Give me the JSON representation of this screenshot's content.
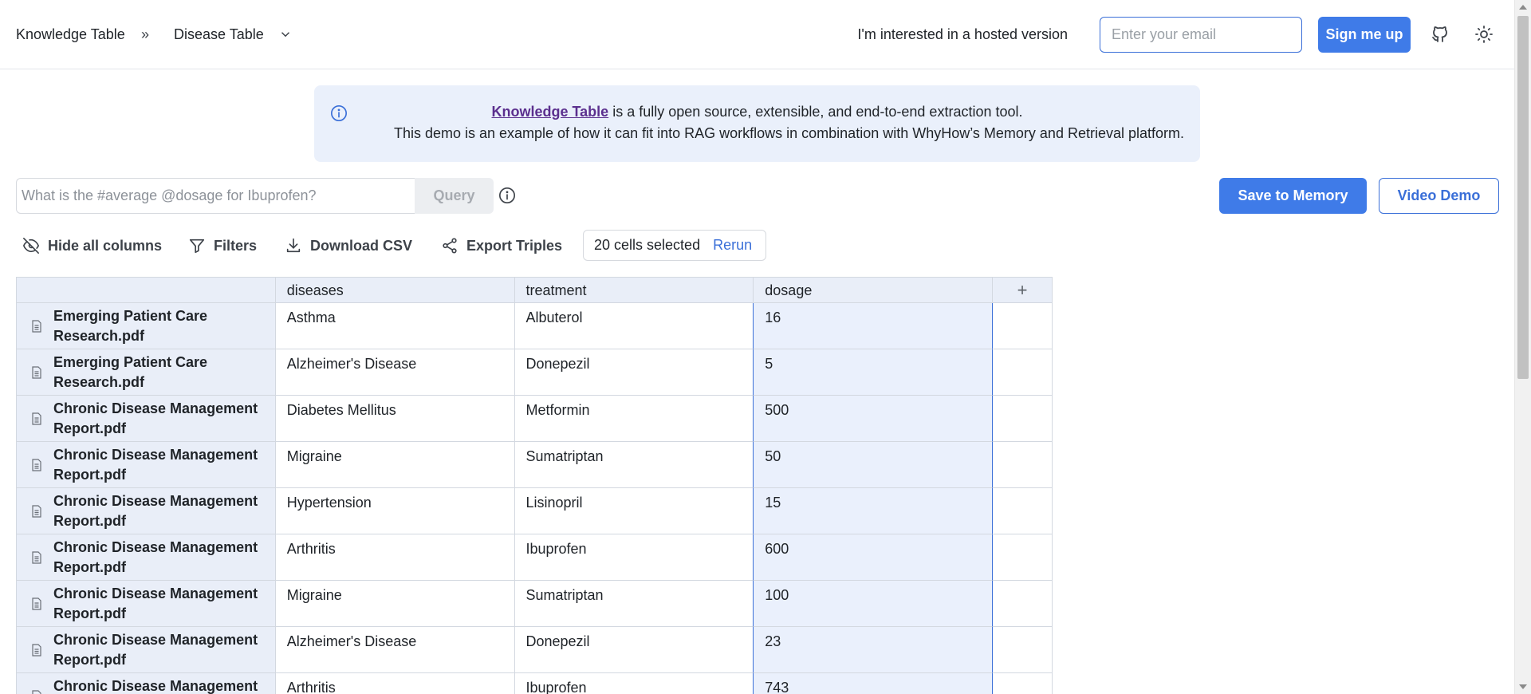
{
  "header": {
    "breadcrumb_root": "Knowledge Table",
    "breadcrumb_separator": "»",
    "breadcrumb_current": "Disease Table",
    "hosted_text": "I'm interested in a hosted version",
    "email_placeholder": "Enter your email",
    "signup_label": "Sign me up"
  },
  "banner": {
    "link_text": "Knowledge Table",
    "line1_rest": " is a fully open source, extensible, and end-to-end extraction tool.",
    "line2": "This demo is an example of how it can fit into RAG workflows in combination with WhyHow’s Memory and Retrieval platform."
  },
  "query": {
    "placeholder": "What is the #average @dosage for Ibuprofen?",
    "button_label": "Query"
  },
  "actions": {
    "save_label": "Save to Memory",
    "video_label": "Video Demo"
  },
  "toolbar": {
    "hide_columns": "Hide all columns",
    "filters": "Filters",
    "download_csv": "Download CSV",
    "export_triples": "Export Triples",
    "cells_selected": "20 cells selected",
    "rerun": "Rerun"
  },
  "table": {
    "columns": [
      "diseases",
      "treatment",
      "dosage"
    ],
    "add_column": "+",
    "rows": [
      {
        "document": "Emerging Patient Care Research.pdf",
        "diseases": "Asthma",
        "treatment": "Albuterol",
        "dosage": "16"
      },
      {
        "document": "Emerging Patient Care Research.pdf",
        "diseases": "Alzheimer's Disease",
        "treatment": "Donepezil",
        "dosage": "5"
      },
      {
        "document": "Chronic Disease Management Report.pdf",
        "diseases": "Diabetes Mellitus",
        "treatment": "Metformin",
        "dosage": "500"
      },
      {
        "document": "Chronic Disease Management Report.pdf",
        "diseases": "Migraine",
        "treatment": "Sumatriptan",
        "dosage": "50"
      },
      {
        "document": "Chronic Disease Management Report.pdf",
        "diseases": "Hypertension",
        "treatment": "Lisinopril",
        "dosage": "15"
      },
      {
        "document": "Chronic Disease Management Report.pdf",
        "diseases": "Arthritis",
        "treatment": "Ibuprofen",
        "dosage": "600"
      },
      {
        "document": "Chronic Disease Management Report.pdf",
        "diseases": "Migraine",
        "treatment": "Sumatriptan",
        "dosage": "100"
      },
      {
        "document": "Chronic Disease Management Report.pdf",
        "diseases": "Alzheimer's Disease",
        "treatment": "Donepezil",
        "dosage": "23"
      },
      {
        "document": "Chronic Disease Management Report.pdf",
        "diseases": "Arthritis",
        "treatment": "Ibuprofen",
        "dosage": "743"
      }
    ]
  },
  "colors": {
    "accent": "#3f7be8",
    "banner_bg": "#eaf0fb",
    "link": "#5b2f8e",
    "selected_cell_bg": "#eaf0fc"
  }
}
